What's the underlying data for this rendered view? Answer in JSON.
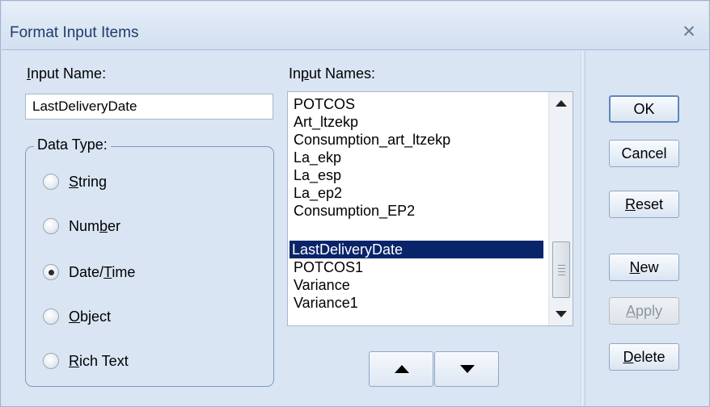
{
  "window": {
    "title": "Format Input Items"
  },
  "input_name": {
    "label_prefix": "",
    "label_mnemonic": "I",
    "label_rest": "nput Name:",
    "value": "LastDeliveryDate"
  },
  "data_type": {
    "group_title": "Data Type:",
    "options": [
      {
        "pre": "",
        "mn": "S",
        "post": "tring",
        "checked": false
      },
      {
        "pre": "Num",
        "mn": "b",
        "post": "er",
        "checked": false
      },
      {
        "pre": "Date/",
        "mn": "T",
        "post": "ime",
        "checked": true
      },
      {
        "pre": "",
        "mn": "O",
        "post": "bject",
        "checked": false
      },
      {
        "pre": "",
        "mn": "R",
        "post": "ich Text",
        "checked": false
      }
    ]
  },
  "input_names": {
    "label_prefix": "In",
    "label_mnemonic": "p",
    "label_rest": "ut Names:",
    "items": [
      "POTCOS",
      "Art_ltzekp",
      "Consumption_art_ltzekp",
      "La_ekp",
      "La_esp",
      "La_ep2",
      "Consumption_EP2",
      "LastDeliveryDate",
      "POTCOS1",
      "Variance",
      "Variance1"
    ],
    "selected": "LastDeliveryDate"
  },
  "buttons": {
    "ok": {
      "pre": "",
      "mn": "",
      "post": "OK"
    },
    "cancel": {
      "pre": "",
      "mn": "",
      "post": "Cancel"
    },
    "reset": {
      "pre": "",
      "mn": "R",
      "post": "eset"
    },
    "new": {
      "pre": "",
      "mn": "N",
      "post": "ew"
    },
    "apply": {
      "pre": "",
      "mn": "A",
      "post": "pply"
    },
    "delete": {
      "pre": "",
      "mn": "D",
      "post": "elete"
    }
  },
  "icons": {
    "close": "close-icon",
    "move_up": "triangle-up-icon",
    "move_down": "triangle-down-icon"
  },
  "colors": {
    "selection": "#0a246a",
    "dialog_bg": "#d9e5f3",
    "title_text": "#1e3b6e"
  }
}
